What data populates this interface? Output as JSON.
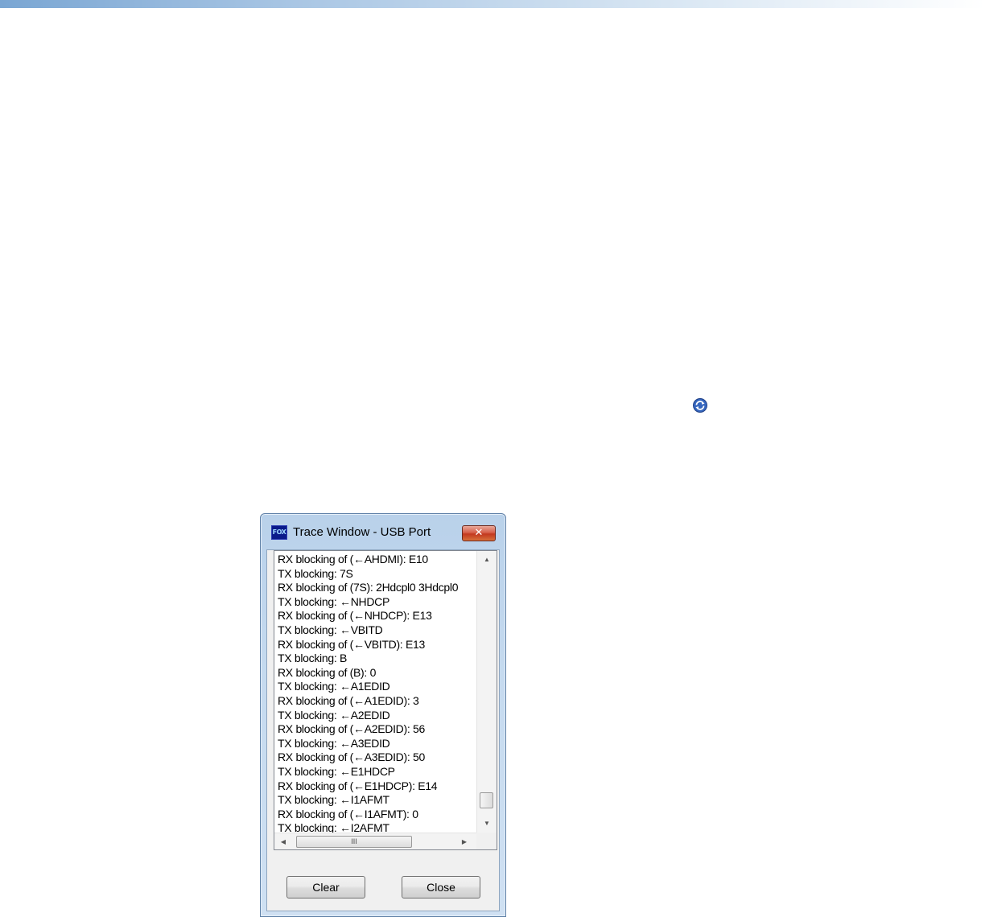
{
  "dialog": {
    "title": "Trace Window - USB Port",
    "app_logo_text": "FOX",
    "close_glyph": "✕",
    "log_lines": [
      "RX blocking of (←AHDMI): E10",
      "TX blocking: 7S",
      "RX blocking of (7S): 2Hdcpl0 3Hdcpl0",
      "TX blocking: ←NHDCP",
      "RX blocking of (←NHDCP): E13",
      "TX blocking: ←VBITD",
      "RX blocking of (←VBITD): E13",
      "TX blocking: B",
      "RX blocking of (B): 0",
      "TX blocking: ←A1EDID",
      "RX blocking of (←A1EDID): 3",
      "TX blocking: ←A2EDID",
      "RX blocking of (←A2EDID): 56",
      "TX blocking: ←A3EDID",
      "RX blocking of (←A3EDID): 50",
      "TX blocking: ←E1HDCP",
      "RX blocking of (←E1HDCP): E14",
      "TX blocking: ←I1AFMT",
      "RX blocking of (←I1AFMT): 0",
      "TX blocking: ←I2AFMT"
    ],
    "scrollbar": {
      "up_arrow": "▲",
      "down_arrow": "▼",
      "left_arrow": "◀",
      "right_arrow": "▶",
      "hthumb_grip": "III"
    },
    "buttons": {
      "clear_label": "Clear",
      "close_label": "Close"
    }
  },
  "icons": {
    "refresh": "refresh-icon"
  },
  "colors": {
    "title_bar": "#c5daef",
    "close_button": "#c2381f",
    "refresh_icon": "#2f5fb3"
  }
}
